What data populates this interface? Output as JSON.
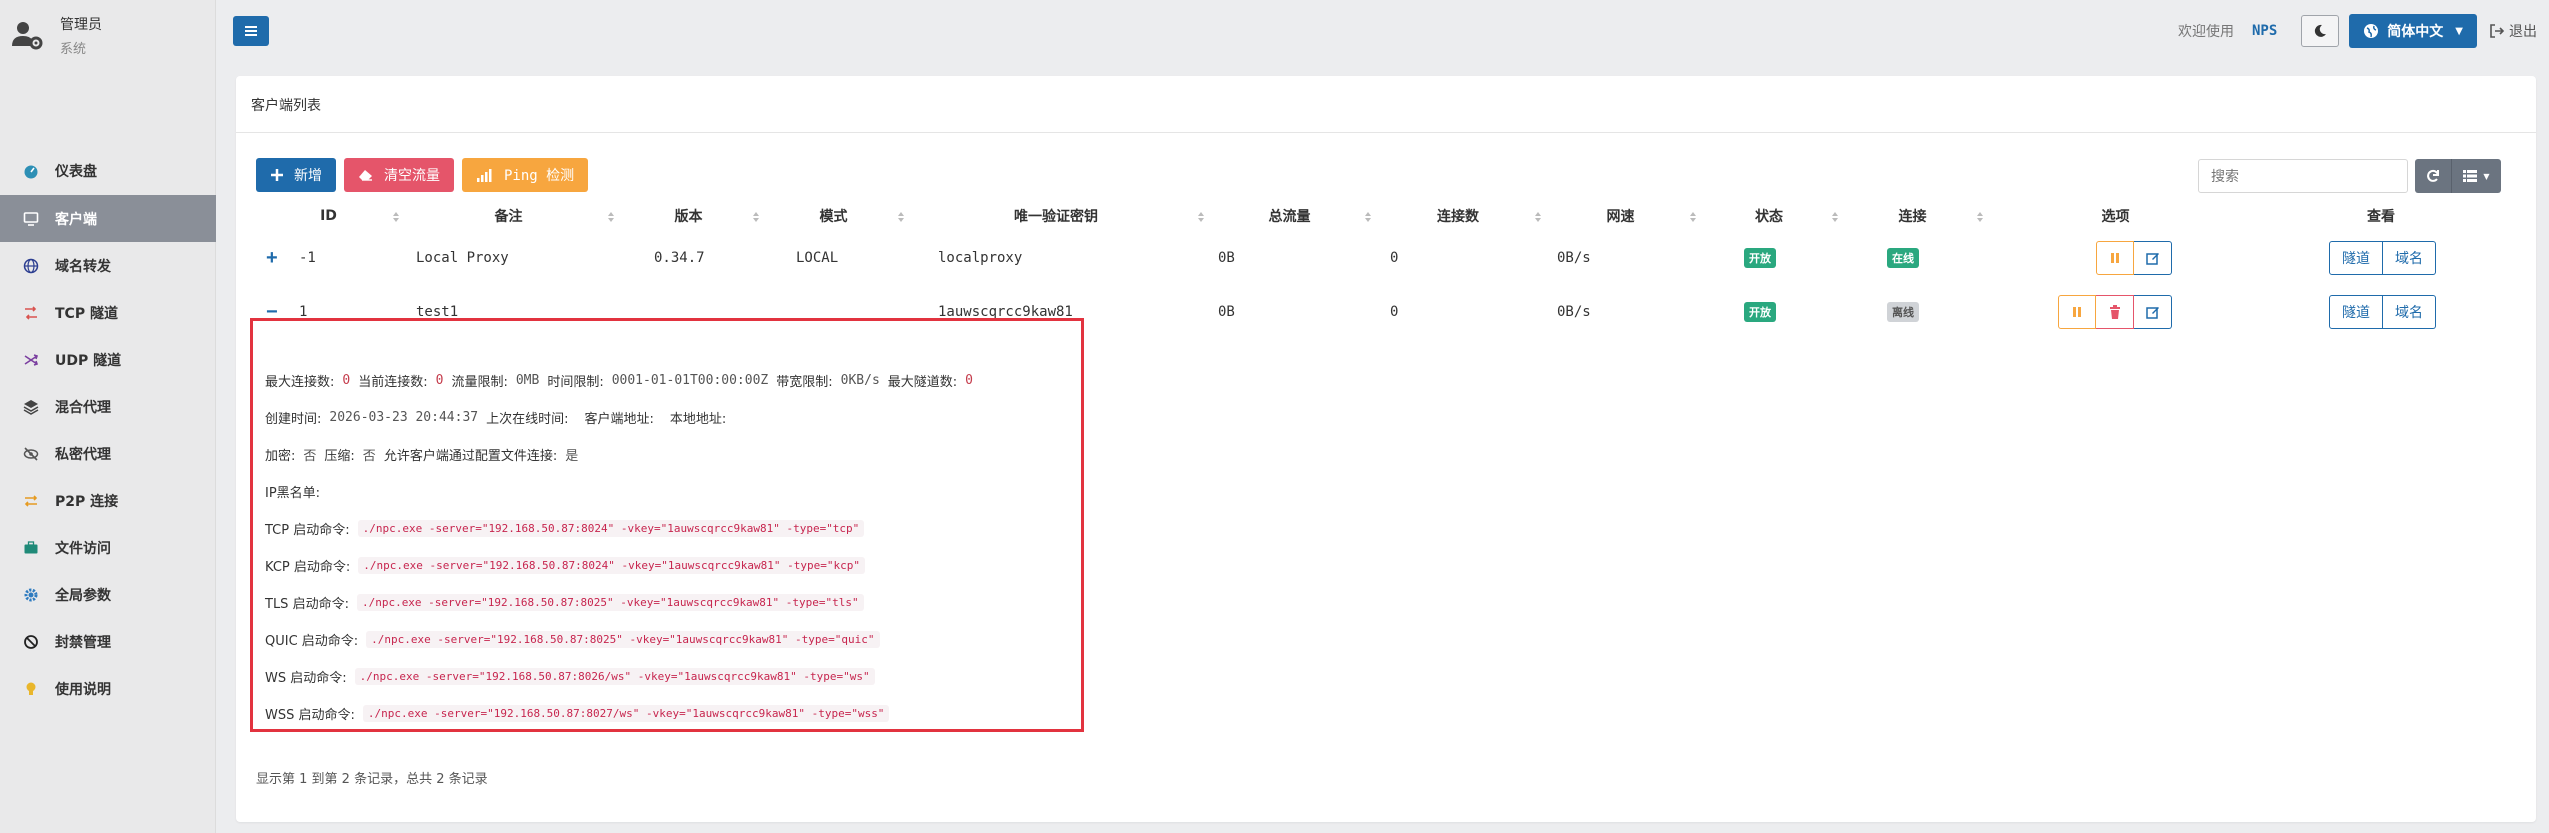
{
  "user": {
    "role": "管理员",
    "sub": "系统"
  },
  "nav": [
    {
      "label": "仪表盘",
      "icon": "dashboard-icon"
    },
    {
      "label": "客户端",
      "icon": "monitor-icon",
      "active": true
    },
    {
      "label": "域名转发",
      "icon": "globe-icon"
    },
    {
      "label": "TCP 隧道",
      "icon": "tcp-icon"
    },
    {
      "label": "UDP 隧道",
      "icon": "udp-icon"
    },
    {
      "label": "混合代理",
      "icon": "layers-icon"
    },
    {
      "label": "私密代理",
      "icon": "eye-slash-icon"
    },
    {
      "label": "P2P 连接",
      "icon": "exchange-icon"
    },
    {
      "label": "文件访问",
      "icon": "briefcase-icon"
    },
    {
      "label": "全局参数",
      "icon": "cog-icon"
    },
    {
      "label": "封禁管理",
      "icon": "ban-icon"
    },
    {
      "label": "使用说明",
      "icon": "lightbulb-icon"
    }
  ],
  "topbar": {
    "welcome": "欢迎使用",
    "brand": "NPS",
    "lang": "简体中文",
    "logout": "退出"
  },
  "card": {
    "title": "客户端列表"
  },
  "toolbar": {
    "add": "新增",
    "clear": "清空流量",
    "ping": "Ping 检测"
  },
  "search": {
    "placeholder": "搜索"
  },
  "columns": [
    "ID",
    "备注",
    "版本",
    "模式",
    "唯一验证密钥",
    "总流量",
    "连接数",
    "网速",
    "状态",
    "连接",
    "选项",
    "查看"
  ],
  "rows": [
    {
      "expander": "+",
      "id": "-1",
      "remark": "Local Proxy",
      "version": "0.34.7",
      "mode": "LOCAL",
      "vkey": "localproxy",
      "traffic": "0B",
      "conns": "0",
      "speed": "0B/s",
      "status": "开放",
      "link": "在线",
      "view": [
        "隧道",
        "域名"
      ]
    },
    {
      "expander": "−",
      "id": "1",
      "remark": "test1",
      "version": "",
      "mode": "",
      "vkey": "1auwscqrcc9kaw81",
      "traffic": "0B",
      "conns": "0",
      "speed": "0B/s",
      "status": "开放",
      "link": "离线",
      "view": [
        "隧道",
        "域名"
      ]
    }
  ],
  "detail": {
    "line1": [
      {
        "label": "最大连接数:",
        "value": "0"
      },
      {
        "label": "当前连接数:",
        "value": "0"
      },
      {
        "label": "流量限制:",
        "value": "0MB"
      },
      {
        "label": "时间限制:",
        "value": "0001-01-01T00:00:00Z"
      },
      {
        "label": "带宽限制:",
        "value": "0KB/s"
      },
      {
        "label": "最大隧道数:",
        "value": "0"
      }
    ],
    "line2": [
      {
        "label": "创建时间:",
        "value": "2026-03-23 20:44:37"
      },
      {
        "label": "上次在线时间:",
        "value": ""
      },
      {
        "label": "客户端地址:",
        "value": ""
      },
      {
        "label": "本地地址:",
        "value": ""
      }
    ],
    "line3": [
      {
        "label": "加密:",
        "value": "否"
      },
      {
        "label": "压缩:",
        "value": "否"
      },
      {
        "label": "允许客户端通过配置文件连接:",
        "value": "是"
      }
    ],
    "blacklist_label": "IP黑名单:",
    "commands": [
      {
        "label": "TCP 启动命令:",
        "cmd": "./npc.exe -server=\"192.168.50.87:8024\" -vkey=\"1auwscqrcc9kaw81\" -type=\"tcp\""
      },
      {
        "label": "KCP 启动命令:",
        "cmd": "./npc.exe -server=\"192.168.50.87:8024\" -vkey=\"1auwscqrcc9kaw81\" -type=\"kcp\""
      },
      {
        "label": "TLS 启动命令:",
        "cmd": "./npc.exe -server=\"192.168.50.87:8025\" -vkey=\"1auwscqrcc9kaw81\" -type=\"tls\""
      },
      {
        "label": "QUIC 启动命令:",
        "cmd": "./npc.exe -server=\"192.168.50.87:8025\" -vkey=\"1auwscqrcc9kaw81\" -type=\"quic\""
      },
      {
        "label": "WS 启动命令:",
        "cmd": "./npc.exe -server=\"192.168.50.87:8026/ws\" -vkey=\"1auwscqrcc9kaw81\" -type=\"ws\""
      },
      {
        "label": "WSS 启动命令:",
        "cmd": "./npc.exe -server=\"192.168.50.87:8027/ws\" -vkey=\"1auwscqrcc9kaw81\" -type=\"wss\""
      }
    ]
  },
  "footer": "显示第 1 到第 2 条记录，总共 2 条记录",
  "colors": {
    "primary": "#1f6bab",
    "danger": "#e5556a",
    "warning": "#f7a63f",
    "success": "#2aa87f",
    "highlight": "#e2333f"
  }
}
